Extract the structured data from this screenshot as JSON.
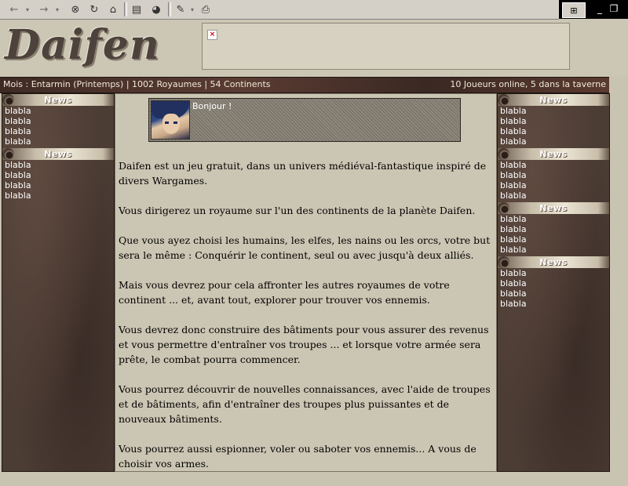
{
  "toolbar": {
    "icons": [
      "back-arrow-icon",
      "back-dropdown-icon",
      "forward-arrow-icon",
      "forward-dropdown-icon",
      "stop-icon",
      "refresh-icon",
      "home-icon",
      "search-icon",
      "history-icon",
      "edit-icon",
      "print-icon"
    ]
  },
  "window": {
    "minimize": "_",
    "restore": "❐",
    "logo": "⊞"
  },
  "header": {
    "logo_text": "Daifen"
  },
  "status": {
    "left": "Mois : Entarmin (Printemps) | 1002 Royaumes | 54 Continents",
    "right": "10 Joueurs online, 5 dans la taverne"
  },
  "left_sidebar": [
    {
      "title": "News",
      "items": [
        "blabla",
        "blabla",
        "blabla",
        "blabla"
      ]
    },
    {
      "title": "News",
      "items": [
        "blabla",
        "blabla",
        "blabla",
        "blabla"
      ]
    }
  ],
  "right_sidebar": [
    {
      "title": "News",
      "items": [
        "blabla",
        "blabla",
        "blabla",
        "blabla"
      ]
    },
    {
      "title": "News",
      "items": [
        "blabla",
        "blabla",
        "blabla",
        "blabla"
      ]
    },
    {
      "title": "News",
      "items": [
        "blabla",
        "blabla",
        "blabla",
        "blabla"
      ]
    },
    {
      "title": "News",
      "items": [
        "blabla",
        "blabla",
        "blabla",
        "blabla"
      ]
    }
  ],
  "greeting": "Bonjour !",
  "paragraphs": [
    "Daifen est un jeu gratuit, dans un univers médiéval-fantastique inspiré de divers Wargames.",
    "Vous dirigerez un royaume sur l'un des continents de la planète Daifen.",
    "Que vous ayez choisi les humains, les elfes, les nains ou les orcs, votre but sera le même : Conquérir le continent, seul ou avec jusqu'à deux alliés.",
    "Mais vous devrez pour cela affronter les autres royaumes de votre continent ... et, avant tout, explorer pour trouver vos ennemis.",
    "Vous devrez donc construire des bâtiments pour vous assurer des revenus et vous permettre d'entraîner vos troupes ... et lorsque votre armée sera prête, le combat pourra commencer.",
    "Vous pourrez découvrir de nouvelles connaissances, avec l'aide de troupes et de bâtiments, afin d'entraîner des troupes plus puissantes et de nouveaux bâtiments.",
    "Vous pourrez aussi espionner, voler ou saboter vos ennemis... A vous de choisir vos armes."
  ]
}
